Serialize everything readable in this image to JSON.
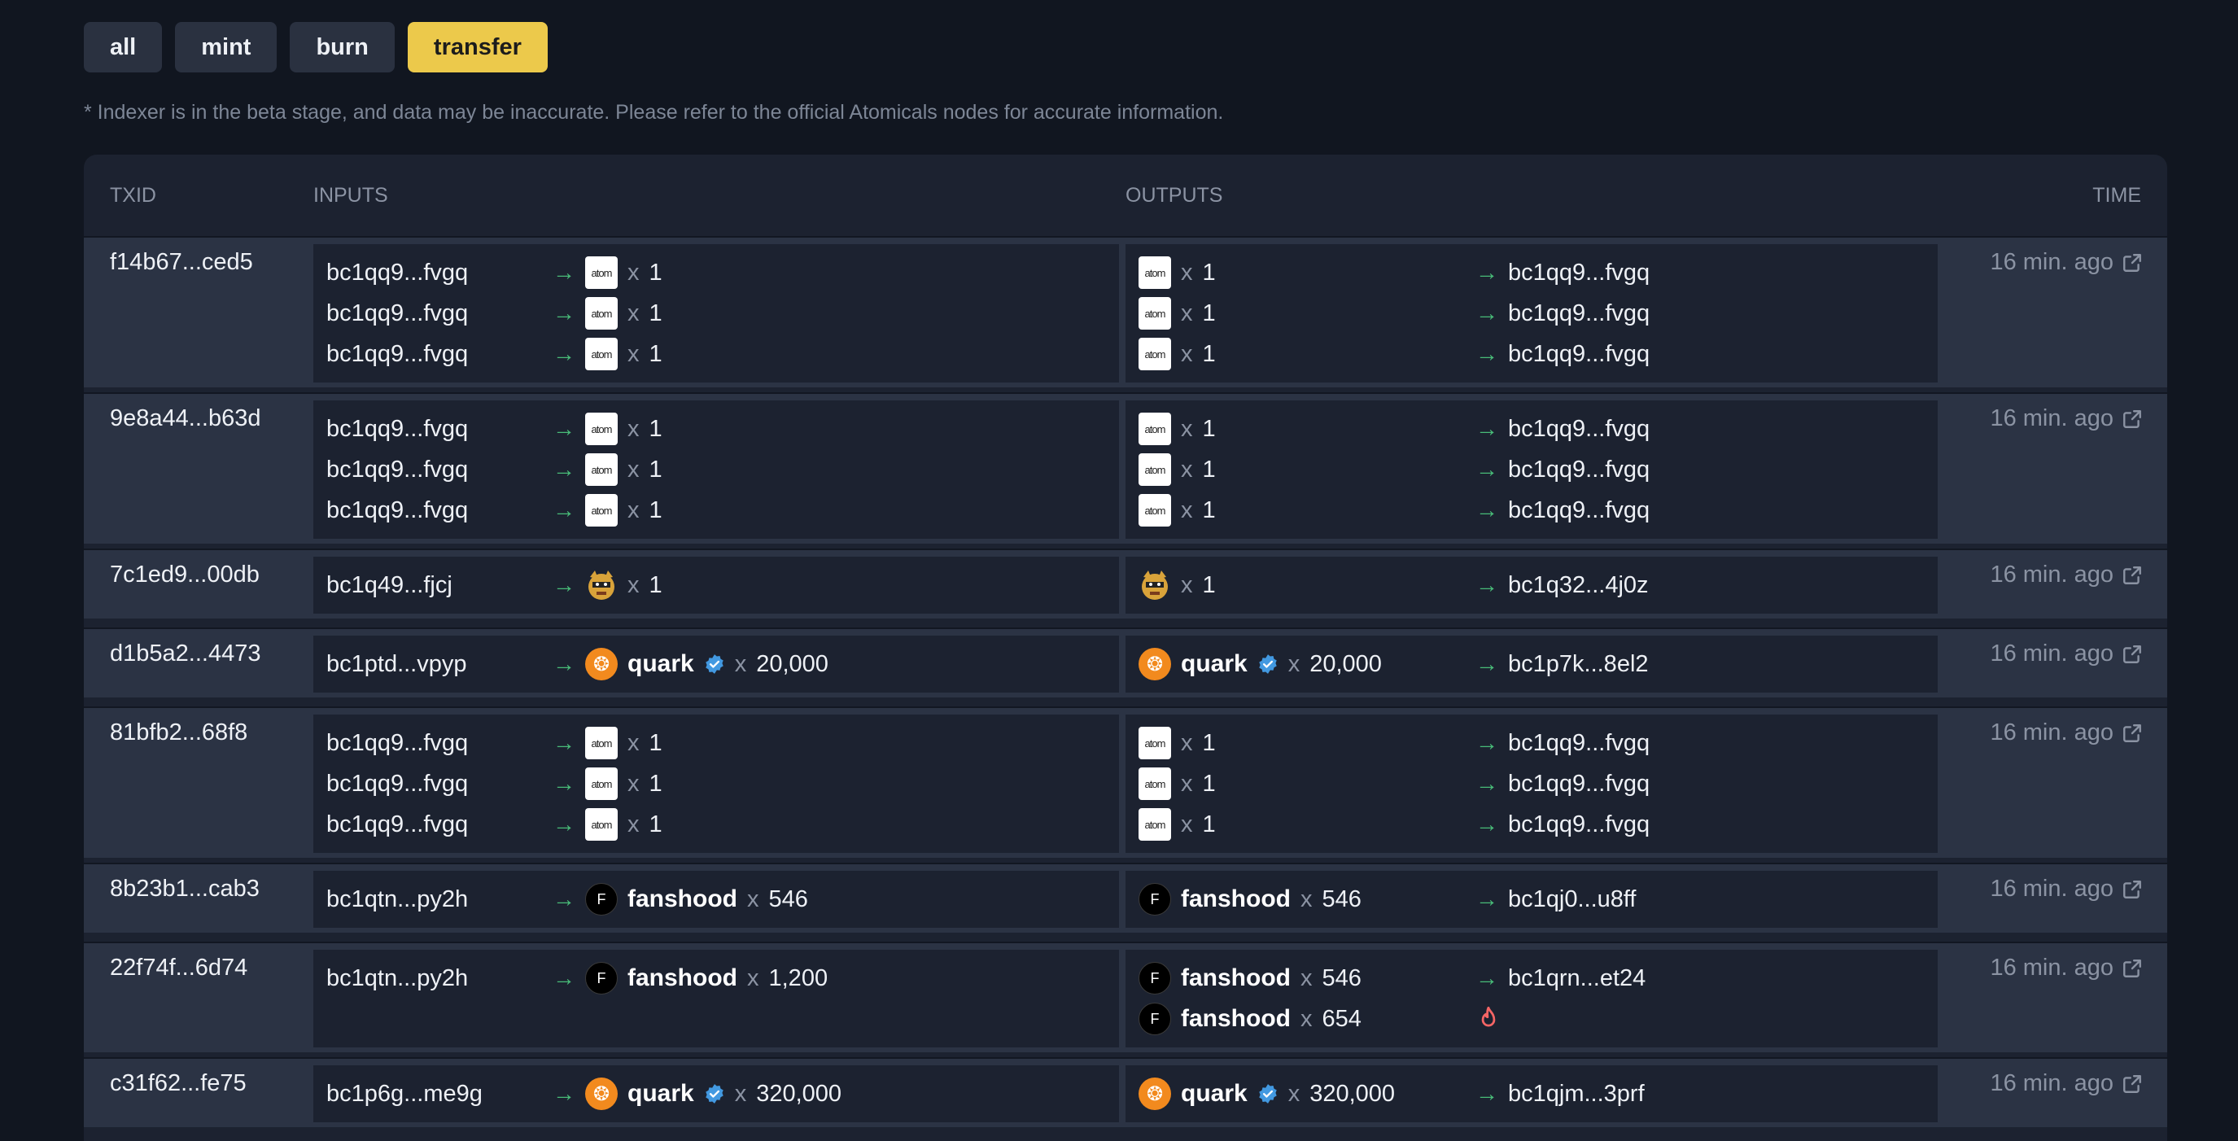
{
  "filters": [
    {
      "label": "all",
      "active": false
    },
    {
      "label": "mint",
      "active": false
    },
    {
      "label": "burn",
      "active": false
    },
    {
      "label": "transfer",
      "active": true
    }
  ],
  "note": "* Indexer is in the beta stage, and data may be inaccurate. Please refer to the official Atomicals nodes for accurate information.",
  "columns": {
    "txid": "TXID",
    "inputs": "INPUTS",
    "outputs": "OUTPUTS",
    "time": "TIME"
  },
  "token_icon_text": {
    "atom": "atom",
    "quark": "❂",
    "fanshood": "F"
  },
  "colors": {
    "accent": "#ecc94b",
    "arrow": "#48bb78",
    "burn": "#f56565",
    "verified": "#4299e1",
    "quark": "#f28a1e"
  },
  "rows": [
    {
      "txid": "f14b67...ced5",
      "time": "16 min. ago",
      "inputs": [
        {
          "address": "bc1qq9...fvgq",
          "token": "atom",
          "name": "",
          "verified": false,
          "amount": "1"
        },
        {
          "address": "bc1qq9...fvgq",
          "token": "atom",
          "name": "",
          "verified": false,
          "amount": "1"
        },
        {
          "address": "bc1qq9...fvgq",
          "token": "atom",
          "name": "",
          "verified": false,
          "amount": "1"
        }
      ],
      "outputs": [
        {
          "address": "bc1qq9...fvgq",
          "token": "atom",
          "name": "",
          "verified": false,
          "amount": "1",
          "burn": false
        },
        {
          "address": "bc1qq9...fvgq",
          "token": "atom",
          "name": "",
          "verified": false,
          "amount": "1",
          "burn": false
        },
        {
          "address": "bc1qq9...fvgq",
          "token": "atom",
          "name": "",
          "verified": false,
          "amount": "1",
          "burn": false
        }
      ]
    },
    {
      "txid": "9e8a44...b63d",
      "time": "16 min. ago",
      "inputs": [
        {
          "address": "bc1qq9...fvgq",
          "token": "atom",
          "name": "",
          "verified": false,
          "amount": "1"
        },
        {
          "address": "bc1qq9...fvgq",
          "token": "atom",
          "name": "",
          "verified": false,
          "amount": "1"
        },
        {
          "address": "bc1qq9...fvgq",
          "token": "atom",
          "name": "",
          "verified": false,
          "amount": "1"
        }
      ],
      "outputs": [
        {
          "address": "bc1qq9...fvgq",
          "token": "atom",
          "name": "",
          "verified": false,
          "amount": "1",
          "burn": false
        },
        {
          "address": "bc1qq9...fvgq",
          "token": "atom",
          "name": "",
          "verified": false,
          "amount": "1",
          "burn": false
        },
        {
          "address": "bc1qq9...fvgq",
          "token": "atom",
          "name": "",
          "verified": false,
          "amount": "1",
          "burn": false
        }
      ]
    },
    {
      "txid": "7c1ed9...00db",
      "time": "16 min. ago",
      "inputs": [
        {
          "address": "bc1q49...fjcj",
          "token": "cat",
          "name": "",
          "verified": false,
          "amount": "1"
        }
      ],
      "outputs": [
        {
          "address": "bc1q32...4j0z",
          "token": "cat",
          "name": "",
          "verified": false,
          "amount": "1",
          "burn": false
        }
      ]
    },
    {
      "txid": "d1b5a2...4473",
      "time": "16 min. ago",
      "inputs": [
        {
          "address": "bc1ptd...vpyp",
          "token": "quark",
          "name": "quark",
          "verified": true,
          "amount": "20,000"
        }
      ],
      "outputs": [
        {
          "address": "bc1p7k...8el2",
          "token": "quark",
          "name": "quark",
          "verified": true,
          "amount": "20,000",
          "burn": false
        }
      ]
    },
    {
      "txid": "81bfb2...68f8",
      "time": "16 min. ago",
      "inputs": [
        {
          "address": "bc1qq9...fvgq",
          "token": "atom",
          "name": "",
          "verified": false,
          "amount": "1"
        },
        {
          "address": "bc1qq9...fvgq",
          "token": "atom",
          "name": "",
          "verified": false,
          "amount": "1"
        },
        {
          "address": "bc1qq9...fvgq",
          "token": "atom",
          "name": "",
          "verified": false,
          "amount": "1"
        }
      ],
      "outputs": [
        {
          "address": "bc1qq9...fvgq",
          "token": "atom",
          "name": "",
          "verified": false,
          "amount": "1",
          "burn": false
        },
        {
          "address": "bc1qq9...fvgq",
          "token": "atom",
          "name": "",
          "verified": false,
          "amount": "1",
          "burn": false
        },
        {
          "address": "bc1qq9...fvgq",
          "token": "atom",
          "name": "",
          "verified": false,
          "amount": "1",
          "burn": false
        }
      ]
    },
    {
      "txid": "8b23b1...cab3",
      "time": "16 min. ago",
      "inputs": [
        {
          "address": "bc1qtn...py2h",
          "token": "fanshood",
          "name": "fanshood",
          "verified": false,
          "amount": "546"
        }
      ],
      "outputs": [
        {
          "address": "bc1qj0...u8ff",
          "token": "fanshood",
          "name": "fanshood",
          "verified": false,
          "amount": "546",
          "burn": false
        }
      ]
    },
    {
      "txid": "22f74f...6d74",
      "time": "16 min. ago",
      "inputs": [
        {
          "address": "bc1qtn...py2h",
          "token": "fanshood",
          "name": "fanshood",
          "verified": false,
          "amount": "1,200"
        }
      ],
      "outputs": [
        {
          "address": "bc1qrn...et24",
          "token": "fanshood",
          "name": "fanshood",
          "verified": false,
          "amount": "546",
          "burn": false
        },
        {
          "address": "",
          "token": "fanshood",
          "name": "fanshood",
          "verified": false,
          "amount": "654",
          "burn": true
        }
      ]
    },
    {
      "txid": "c31f62...fe75",
      "time": "16 min. ago",
      "inputs": [
        {
          "address": "bc1p6g...me9g",
          "token": "quark",
          "name": "quark",
          "verified": true,
          "amount": "320,000"
        }
      ],
      "outputs": [
        {
          "address": "bc1qjm...3prf",
          "token": "quark",
          "name": "quark",
          "verified": true,
          "amount": "320,000",
          "burn": false
        }
      ]
    }
  ]
}
